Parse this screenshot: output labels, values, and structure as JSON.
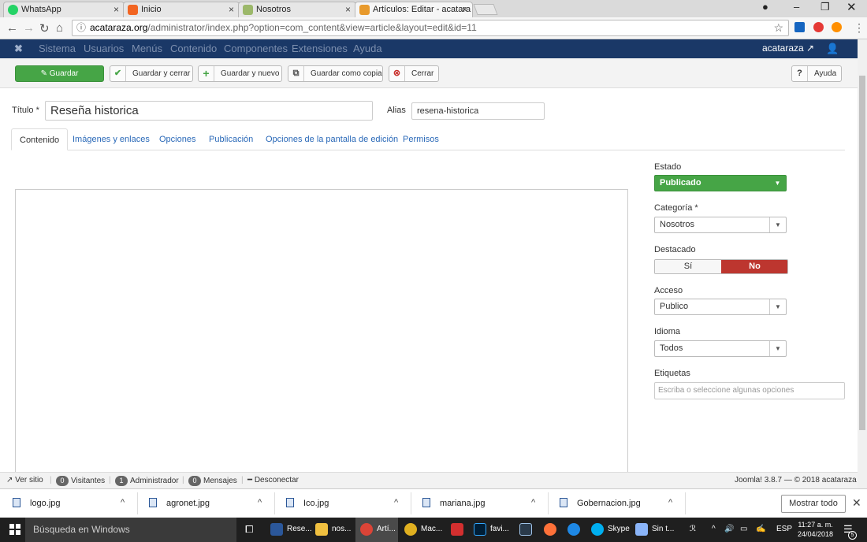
{
  "browser": {
    "tabs": [
      {
        "title": "WhatsApp",
        "color": "#25d366"
      },
      {
        "title": "Inicio",
        "color": "#f26522"
      },
      {
        "title": "Nosotros",
        "color": "#8c8c8c"
      },
      {
        "title": "Artículos: Editar - acatara",
        "color": "#e89a2c"
      }
    ],
    "url_host": "acataraza.org",
    "url_path": "/administrator/index.php?option=com_content&view=article&layout=edit&id=11"
  },
  "joomla_menu": {
    "items": [
      "Sistema",
      "Usuarios",
      "Menús",
      "Contenido",
      "Componentes",
      "Extensiones",
      "Ayuda"
    ],
    "user": "acataraza"
  },
  "toolbar": {
    "save": "Guardar",
    "save_close": "Guardar y cerrar",
    "save_new": "Guardar y nuevo",
    "save_copy": "Guardar como copia",
    "close": "Cerrar",
    "help": "Ayuda"
  },
  "form": {
    "title_label": "Título *",
    "title_value": "Reseña historica",
    "alias_label": "Alias",
    "alias_value": "resena-historica",
    "tabs": [
      "Contenido",
      "Imágenes y enlaces",
      "Opciones",
      "Publicación",
      "Opciones de la pantalla de edición",
      "Permisos"
    ]
  },
  "sidebar": {
    "estado_label": "Estado",
    "estado_value": "Publicado",
    "categoria_label": "Categoría *",
    "categoria_value": "Nosotros",
    "destacado_label": "Destacado",
    "destacado_si": "Sí",
    "destacado_no": "No",
    "acceso_label": "Acceso",
    "acceso_value": "Publico",
    "idioma_label": "Idioma",
    "idioma_value": "Todos",
    "etiquetas_label": "Etiquetas",
    "etiquetas_placeholder": "Escriba o seleccione algunas opciones"
  },
  "status_bar": {
    "ver_sitio": "Ver sitio",
    "visitantes_count": "0",
    "visitantes": "Visitantes",
    "admin_count": "1",
    "administrador": "Administrador",
    "mensajes_count": "0",
    "mensajes": "Mensajes",
    "desconectar": "Desconectar",
    "version": "Joomla! 3.8.7 — © 2018 acataraza"
  },
  "downloads": {
    "files": [
      "logo.jpg",
      "agronet.jpg",
      "Ico.jpg",
      "mariana.jpg",
      "Gobernacion.jpg"
    ],
    "show_all": "Mostrar todo"
  },
  "taskbar": {
    "search": "Búsqueda en Windows",
    "apps": [
      "Rese...",
      "nos...",
      "Artí...",
      "Mac...",
      "favi...",
      "Skype",
      "Sin t..."
    ],
    "lang": "ESP",
    "time": "11:27 a. m.",
    "date": "24/04/2018",
    "notif_count": "5"
  }
}
